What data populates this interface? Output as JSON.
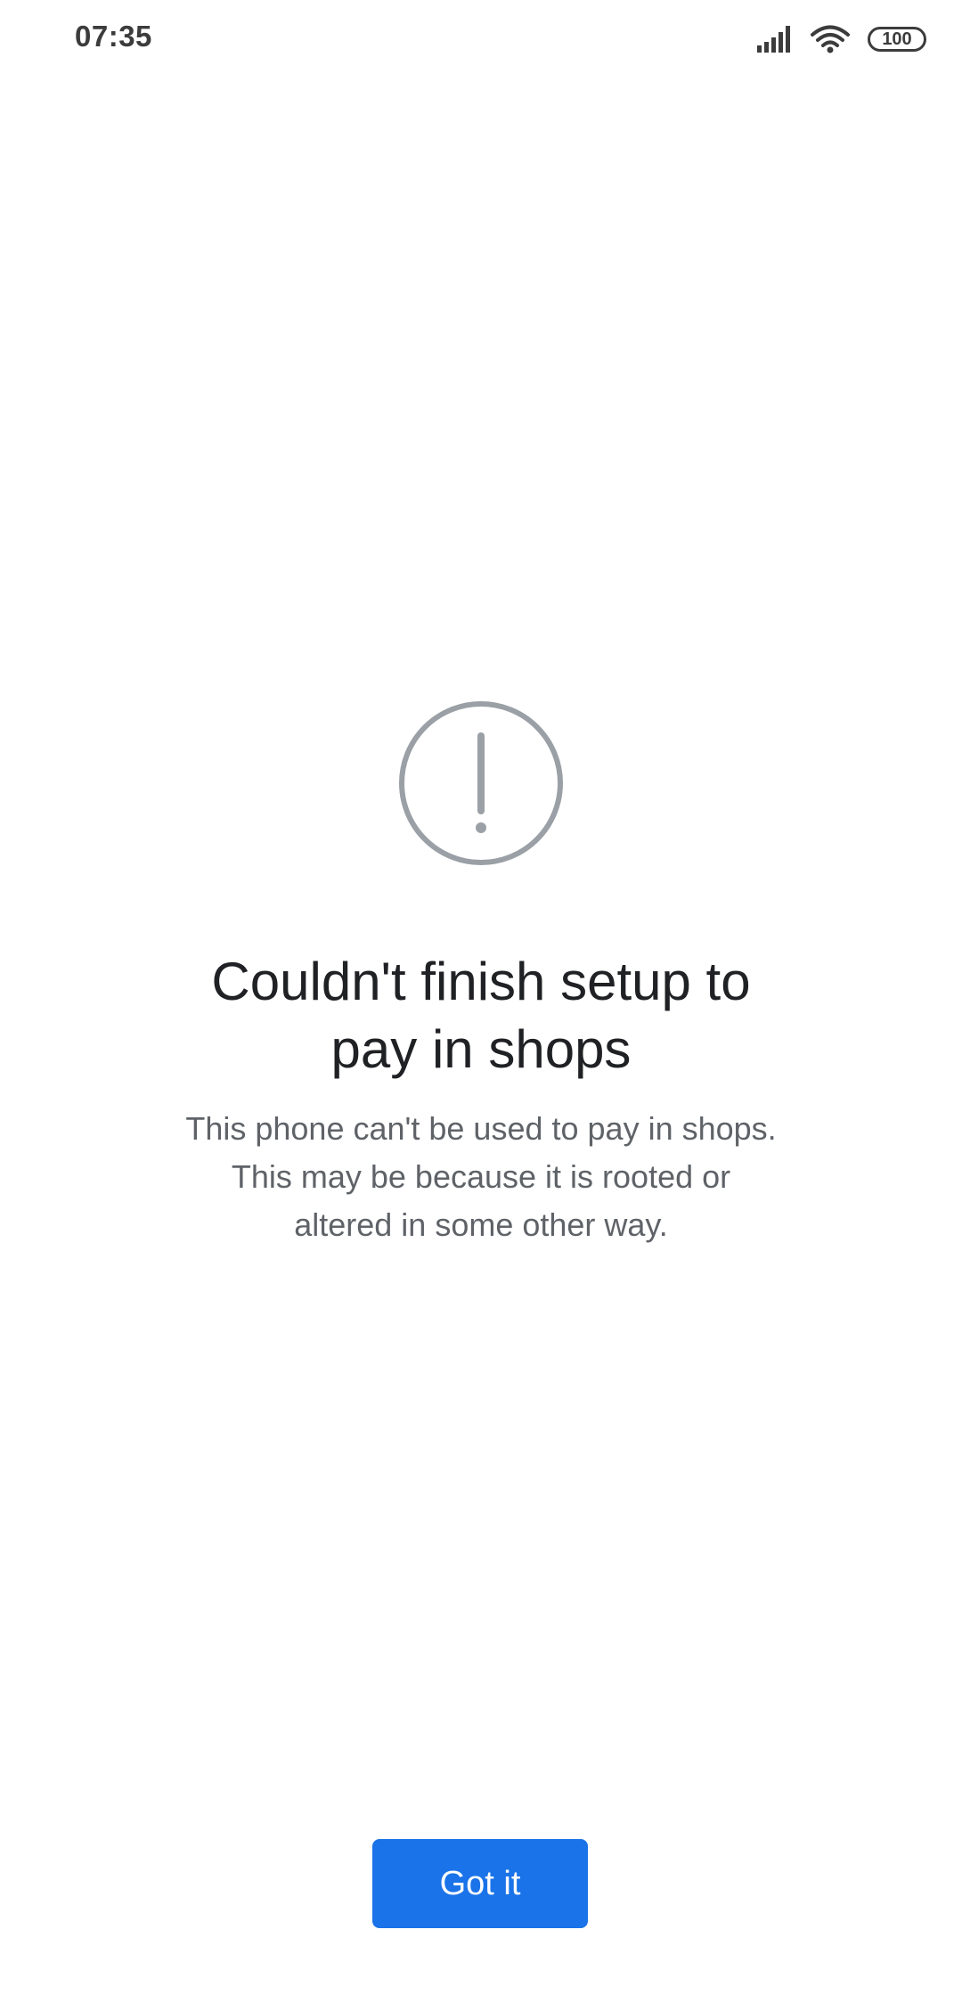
{
  "status_bar": {
    "time": "07:35",
    "battery_level": "100",
    "icons": [
      "signal-icon",
      "wifi-icon",
      "battery-icon"
    ]
  },
  "dialog": {
    "icon": "exclamation-circle-icon",
    "title_line1": "Couldn't finish setup to",
    "title_line2": "pay in shops",
    "message_line1": "This phone can't be used to pay in shops.",
    "message_line2": "This may be because it is rooted or",
    "message_line3": "altered in some other way.",
    "button_label": "Got it"
  },
  "colors": {
    "accent": "#1a73e8",
    "title_text": "#202124",
    "body_text": "#5f6368",
    "icon_gray": "#9aa0a6"
  }
}
